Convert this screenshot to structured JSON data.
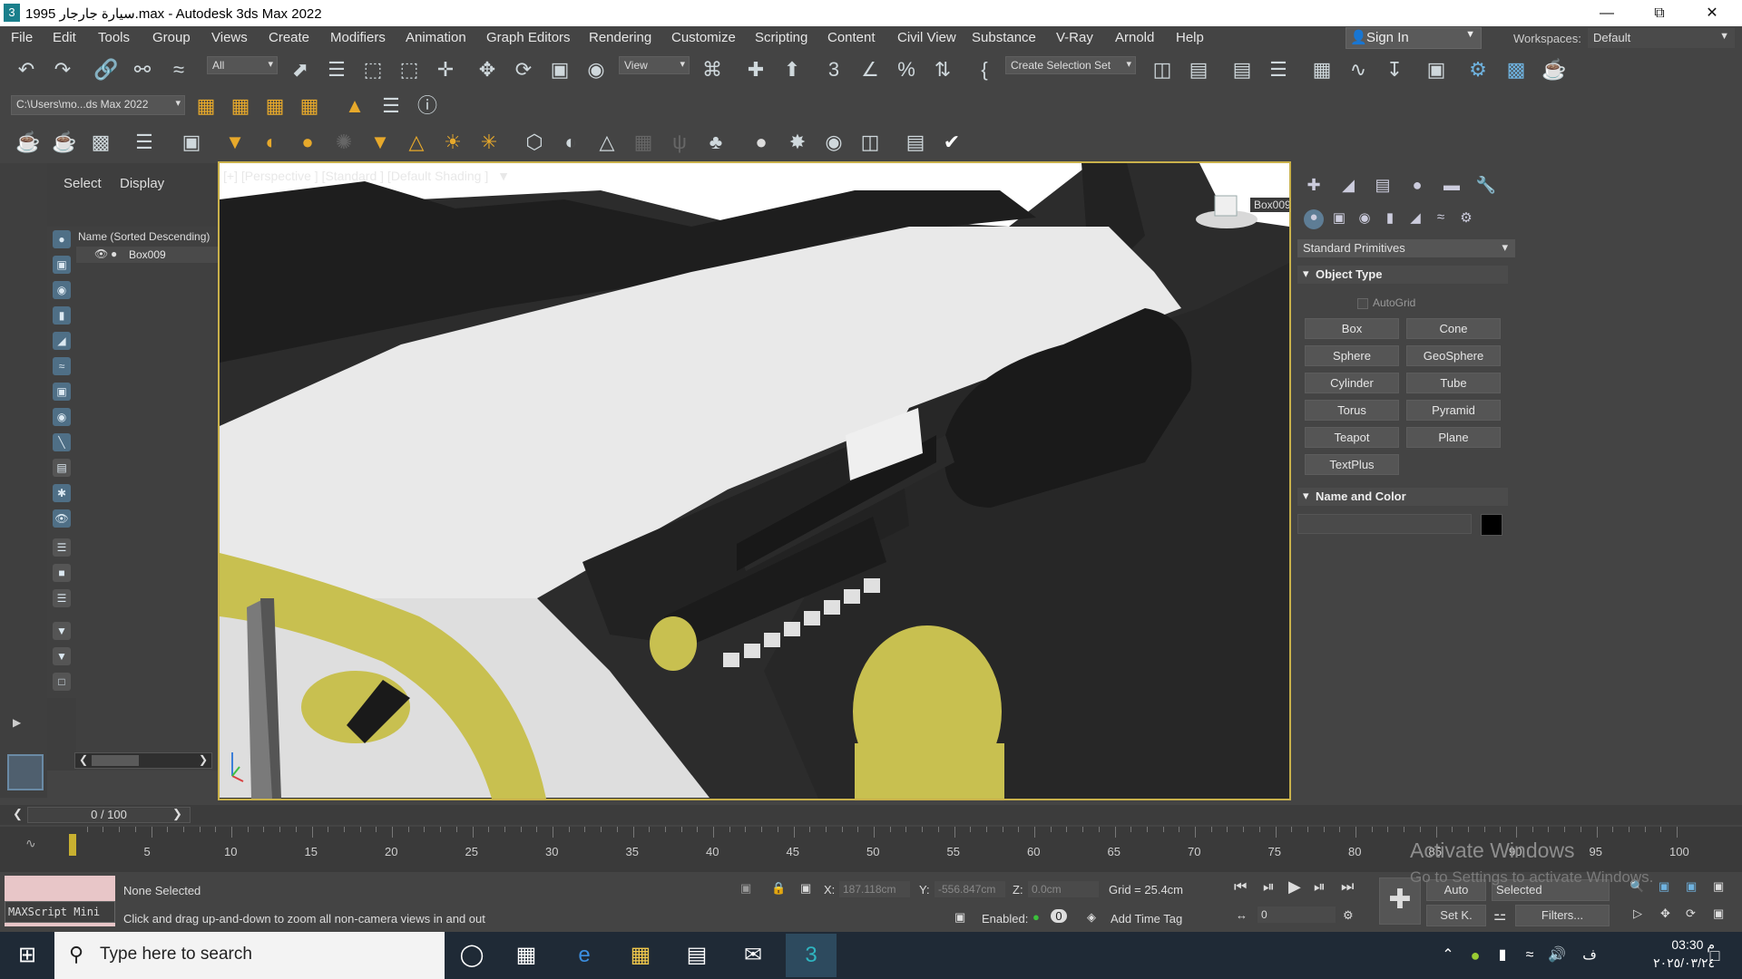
{
  "window": {
    "title": "سيارة جارجار 1995.max - Autodesk 3ds Max 2022",
    "app_icon": "3"
  },
  "menu": [
    "File",
    "Edit",
    "Tools",
    "Group",
    "Views",
    "Create",
    "Modifiers",
    "Animation",
    "Graph Editors",
    "Rendering",
    "Customize",
    "Scripting",
    "Content",
    "Civil View",
    "Substance",
    "V-Ray",
    "Arnold",
    "Help"
  ],
  "signin": {
    "label": "Sign In"
  },
  "workspaces": {
    "label": "Workspaces:",
    "value": "Default"
  },
  "toolbar": {
    "filter_all": "All",
    "view": "View",
    "selection_set": "Create Selection Set",
    "project_path": "C:\\Users\\mo...ds Max 2022"
  },
  "explorer": {
    "tab_select": "Select",
    "tab_display": "Display",
    "header": "Name (Sorted Descending)",
    "item": "Box009"
  },
  "viewport": {
    "label": "[+] [Perspective ] [Standard ] [Default Shading ]",
    "viewcube_label": "Box009"
  },
  "command_panel": {
    "primitives": "Standard Primitives",
    "object_type": "Object Type",
    "autogrid": "AutoGrid",
    "buttons": [
      "Box",
      "Cone",
      "Sphere",
      "GeoSphere",
      "Cylinder",
      "Tube",
      "Torus",
      "Pyramid",
      "Teapot",
      "Plane",
      "TextPlus"
    ],
    "name_and_color": "Name and Color",
    "object_color": "#000000"
  },
  "timeslider": {
    "frame": "0 / 100"
  },
  "track": {
    "ticks": [
      "5",
      "10",
      "15",
      "20",
      "25",
      "30",
      "35",
      "40",
      "45",
      "50",
      "55",
      "60",
      "65",
      "70",
      "75",
      "80",
      "85",
      "90",
      "95",
      "100"
    ]
  },
  "status": {
    "maxscript": "MAXScript Mini",
    "selection": "None Selected",
    "prompt": "Click and drag up-and-down to zoom all non-camera views in and out",
    "x_label": "X:",
    "x_value": "187.118cm",
    "y_label": "Y:",
    "y_value": "-556.847cm",
    "z_label": "Z:",
    "z_value": "0.0cm",
    "grid": "Grid = 25.4cm",
    "enabled": "Enabled:",
    "enabled_value": "0",
    "add_time_tag": "Add Time Tag",
    "auto": "Auto",
    "selected": "Selected",
    "setk": "Set K.",
    "filters": "Filters...",
    "frame_field": "0"
  },
  "watermark": {
    "line1": "Activate Windows",
    "line2": "Go to Settings to activate Windows."
  },
  "taskbar": {
    "search_placeholder": "Type here to search",
    "lang": "ف",
    "time": "03:30 م",
    "date": "٢٠٢٥/٠٣/٢٤"
  },
  "colors": {
    "viewport_border": "#c9b14b",
    "accent": "#e7a92b",
    "yellow_mesh": "#c8c050"
  }
}
